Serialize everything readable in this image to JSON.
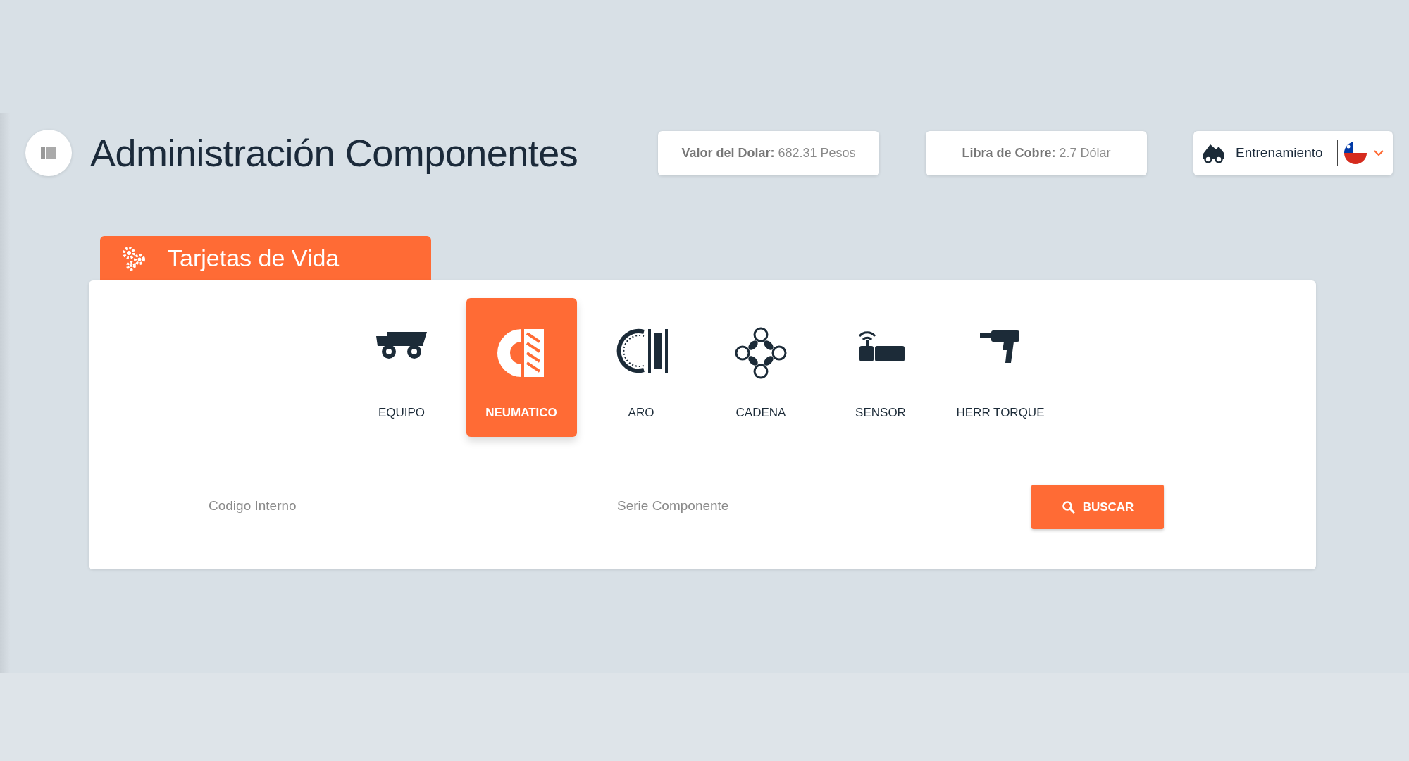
{
  "header": {
    "title": "Administración Componentes"
  },
  "indicators": [
    {
      "label": "Valor del Dolar:",
      "value": "682.31 Pesos"
    },
    {
      "label": "Libra de Cobre:",
      "value": "2.7 Dólar"
    }
  ],
  "environment": {
    "label": "Entrenamiento"
  },
  "section": {
    "title": "Tarjetas de Vida"
  },
  "components": [
    {
      "kind": "truck",
      "label": "EQUIPO",
      "selected": false
    },
    {
      "kind": "tire",
      "label": "NEUMATICO",
      "selected": true
    },
    {
      "kind": "rim",
      "label": "ARO",
      "selected": false
    },
    {
      "kind": "chain",
      "label": "CADENA",
      "selected": false
    },
    {
      "kind": "sensor",
      "label": "SENSOR",
      "selected": false
    },
    {
      "kind": "tool",
      "label": "HERR TORQUE",
      "selected": false
    }
  ],
  "fields": [
    {
      "placeholder": "Codigo Interno"
    },
    {
      "placeholder": "Serie Componente"
    }
  ],
  "search_button": {
    "label": "BUSCAR"
  }
}
